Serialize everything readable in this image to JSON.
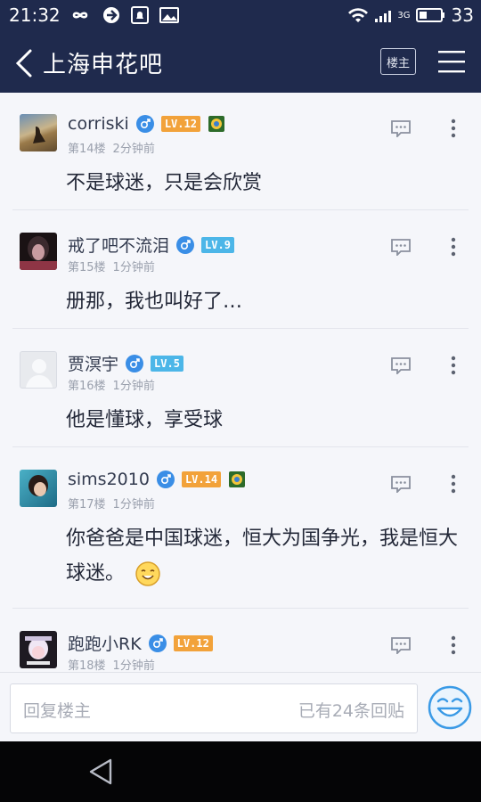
{
  "status_bar": {
    "time": "21:32",
    "network_label": "3G",
    "battery": "33"
  },
  "nav": {
    "title": "上海申花吧",
    "owner_button": "楼主"
  },
  "posts": [
    {
      "username": "corriski",
      "level": "LV.12",
      "level_color": "orange",
      "has_badge": true,
      "floor": "第14楼",
      "time": "2分钟前",
      "content": "不是球迷，只是会欣赏"
    },
    {
      "username": "戒了吧不流泪",
      "level": "LV.9",
      "level_color": "blue",
      "has_badge": false,
      "floor": "第15楼",
      "time": "1分钟前",
      "content": "册那，我也叫好了…"
    },
    {
      "username": "贾溟宇",
      "level": "LV.5",
      "level_color": "blue",
      "has_badge": false,
      "floor": "第16楼",
      "time": "1分钟前",
      "content": "他是懂球，享受球"
    },
    {
      "username": "sims2010",
      "level": "LV.14",
      "level_color": "orange",
      "has_badge": true,
      "floor": "第17楼",
      "time": "1分钟前",
      "content": "你爸爸是中国球迷，恒大为国争光，我是恒大球迷。"
    },
    {
      "username": "跑跑小RK",
      "level": "LV.12",
      "level_color": "orange",
      "has_badge": false,
      "floor": "第18楼",
      "time": "1分钟前",
      "content": ""
    }
  ],
  "reply_bar": {
    "placeholder": "回复楼主",
    "count": "已有24条回贴"
  },
  "colors": {
    "header_bg": "#1f2a4d",
    "gender_blue": "#3a8ee6",
    "level_orange": "#f2a23a",
    "level_blue": "#4cb6e8"
  }
}
